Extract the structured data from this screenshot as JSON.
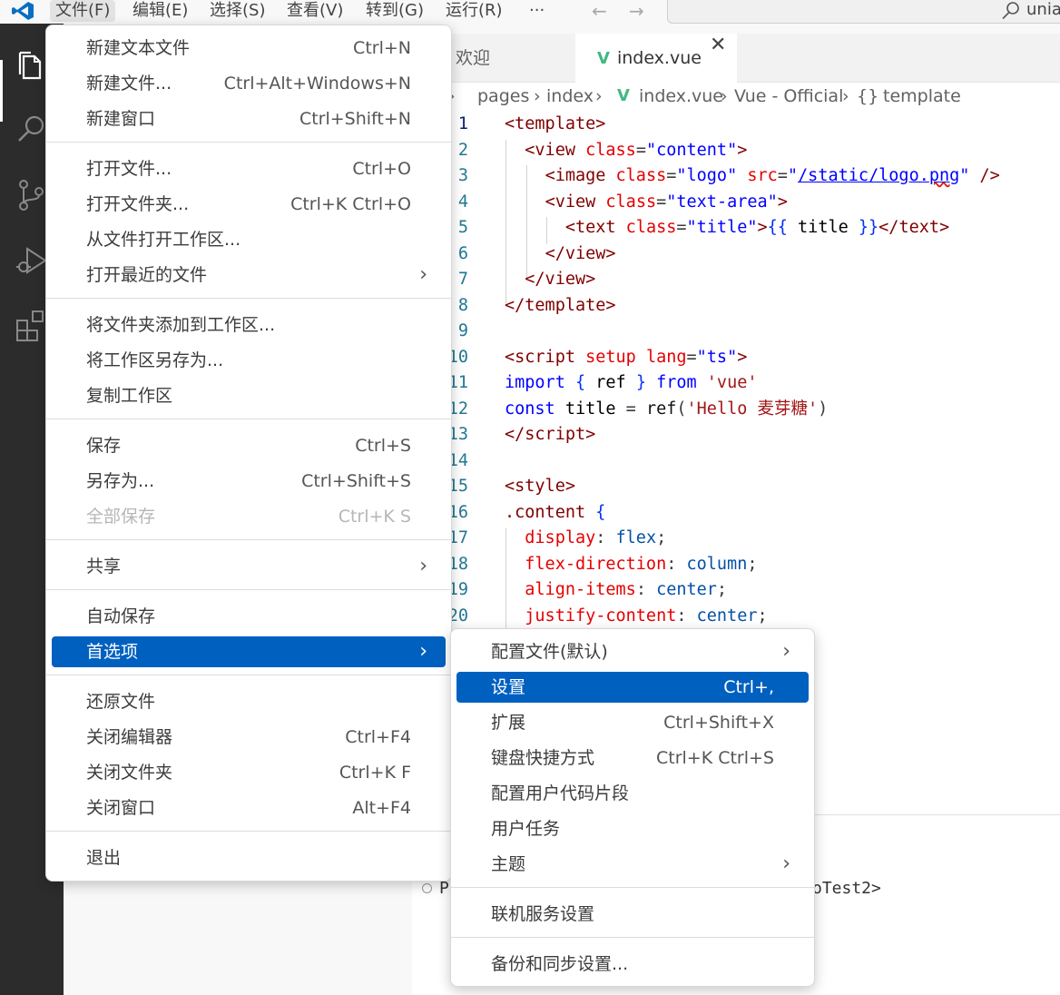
{
  "menubar": {
    "items": [
      "文件(F)",
      "编辑(E)",
      "选择(S)",
      "查看(V)",
      "转到(G)",
      "运行(R)",
      "···"
    ],
    "search_text": "uniap"
  },
  "tabs": [
    {
      "label": "欢迎",
      "active": false
    },
    {
      "label": "index.vue",
      "active": true
    }
  ],
  "breadcrumb": [
    "pages",
    "index",
    "index.vue",
    "Vue - Official",
    "template"
  ],
  "editor": {
    "line_numbers": [
      "1",
      "2",
      "3",
      "4",
      "5",
      "6",
      "7",
      "8",
      "9",
      "10",
      "11",
      "12",
      "13",
      "14",
      "15",
      "16",
      "17",
      "18",
      "19",
      "20"
    ]
  },
  "panel": {
    "prompt_start": "P",
    "prompt_end": "oTest2>"
  },
  "file_menu": {
    "groups": [
      [
        {
          "label": "新建文本文件",
          "shortcut": "Ctrl+N"
        },
        {
          "label": "新建文件...",
          "shortcut": "Ctrl+Alt+Windows+N"
        },
        {
          "label": "新建窗口",
          "shortcut": "Ctrl+Shift+N"
        }
      ],
      [
        {
          "label": "打开文件...",
          "shortcut": "Ctrl+O"
        },
        {
          "label": "打开文件夹...",
          "shortcut": "Ctrl+K Ctrl+O"
        },
        {
          "label": "从文件打开工作区...",
          "shortcut": ""
        },
        {
          "label": "打开最近的文件",
          "shortcut": "",
          "submenu": true
        }
      ],
      [
        {
          "label": "将文件夹添加到工作区...",
          "shortcut": ""
        },
        {
          "label": "将工作区另存为...",
          "shortcut": ""
        },
        {
          "label": "复制工作区",
          "shortcut": ""
        }
      ],
      [
        {
          "label": "保存",
          "shortcut": "Ctrl+S"
        },
        {
          "label": "另存为...",
          "shortcut": "Ctrl+Shift+S"
        },
        {
          "label": "全部保存",
          "shortcut": "Ctrl+K S",
          "disabled": true
        }
      ],
      [
        {
          "label": "共享",
          "shortcut": "",
          "submenu": true
        }
      ],
      [
        {
          "label": "自动保存",
          "shortcut": ""
        },
        {
          "label": "首选项",
          "shortcut": "",
          "submenu": true,
          "selected": true
        }
      ],
      [
        {
          "label": "还原文件",
          "shortcut": ""
        },
        {
          "label": "关闭编辑器",
          "shortcut": "Ctrl+F4"
        },
        {
          "label": "关闭文件夹",
          "shortcut": "Ctrl+K F"
        },
        {
          "label": "关闭窗口",
          "shortcut": "Alt+F4"
        }
      ],
      [
        {
          "label": "退出",
          "shortcut": ""
        }
      ]
    ]
  },
  "prefs_menu": {
    "groups": [
      [
        {
          "label": "配置文件(默认)",
          "shortcut": "",
          "submenu": true
        },
        {
          "label": "设置",
          "shortcut": "Ctrl+,",
          "selected": true
        },
        {
          "label": "扩展",
          "shortcut": "Ctrl+Shift+X"
        },
        {
          "label": "键盘快捷方式",
          "shortcut": "Ctrl+K Ctrl+S"
        },
        {
          "label": "配置用户代码片段",
          "shortcut": ""
        },
        {
          "label": "用户任务",
          "shortcut": ""
        },
        {
          "label": "主题",
          "shortcut": "",
          "submenu": true
        }
      ],
      [
        {
          "label": "联机服务设置",
          "shortcut": ""
        }
      ],
      [
        {
          "label": "备份和同步设置...",
          "shortcut": ""
        }
      ]
    ]
  },
  "colors": {
    "accent": "#0060c0",
    "activity_bar": "#2c2c2c",
    "vue_green": "#41b883"
  }
}
